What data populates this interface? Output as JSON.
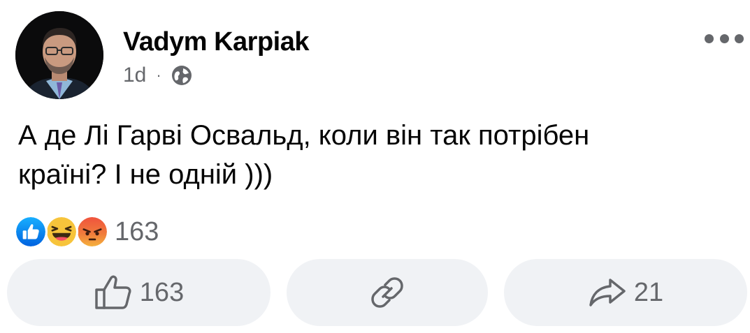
{
  "post": {
    "author": "Vadym Karpiak",
    "time": "1d",
    "separator": "·",
    "privacy_icon": "globe-icon",
    "text_lines": [
      "А де Лі Гарві Освальд, коли він так потрібен",
      "країні? І не одній )))"
    ]
  },
  "reactions": {
    "icons": [
      "like-icon",
      "haha-icon",
      "angry-icon"
    ],
    "count": "163"
  },
  "actions": {
    "like": {
      "icon": "thumbs-up-icon",
      "count": "163"
    },
    "copy_link": {
      "icon": "link-icon"
    },
    "share": {
      "icon": "share-arrow-icon",
      "count": "21"
    }
  },
  "colors": {
    "text": "#050505",
    "secondary": "#65676b",
    "button_bg": "#f0f2f5",
    "like_blue": "#1877f2",
    "angry": "#e8513b",
    "haha": "#f7b928"
  }
}
